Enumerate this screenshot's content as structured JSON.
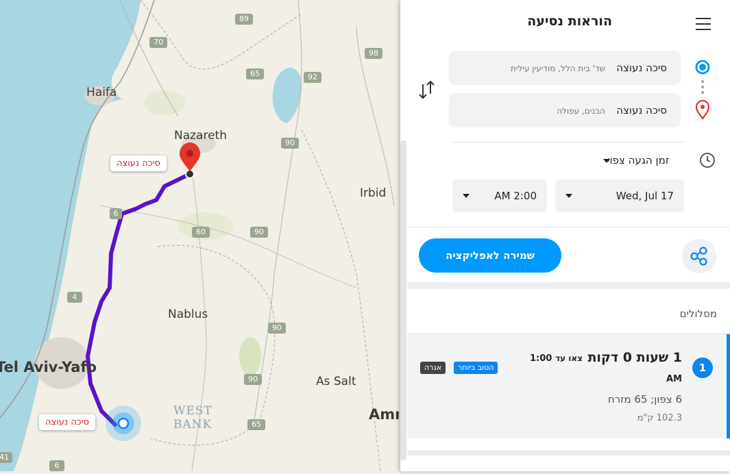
{
  "map": {
    "places": {
      "haifa": "Haifa",
      "nazareth": "Nazareth",
      "irbid": "Irbid",
      "nablus": "Nablus",
      "tel_aviv": "Tel Aviv-Yafo",
      "as_salt": "As Salt",
      "amman": "Amman",
      "west": "WEST",
      "bank": "BANK"
    },
    "road_shields": [
      "89",
      "70",
      "65",
      "92",
      "98",
      "90",
      "6",
      "60",
      "90",
      "4",
      "90",
      "90",
      "65",
      "6",
      "41"
    ],
    "origin_label": "סיכה נעוצה",
    "destination_label": "סיכה נעוצה",
    "colors": {
      "route": "#5b12c8",
      "water": "#a8d6e2",
      "land": "#f1efe6",
      "pin": "#e5342b"
    }
  },
  "panel": {
    "title": "הוראות נסיעה",
    "origin": {
      "main": "סיכה נעוצה",
      "sub": "שד' בית הלל, מודיעין עילית"
    },
    "destination": {
      "main": "סיכה נעוצה",
      "sub": "הבנים, עפולה"
    },
    "time_mode": "זמן הגעה צפוי",
    "date": "Wed, Jul 17",
    "time": "AM 2:00",
    "save_button": "שמירה לאפליקציה",
    "routes_heading": "מסלולים",
    "route": {
      "index": "1",
      "duration": "1 שעות 0 דקות",
      "leave_by_label": "צאו עד",
      "leave_by_time": "1:00",
      "leave_by_ampm": "AM",
      "badge_best": "הטוב ביותר",
      "badge_toll": "אגרה",
      "via": "6 צפון; 65 מזרח",
      "distance": "102.3 ק\"מ"
    },
    "colors": {
      "accent": "#0099ff",
      "badge_best": "#0b86f0",
      "badge_toll": "#444444"
    }
  }
}
